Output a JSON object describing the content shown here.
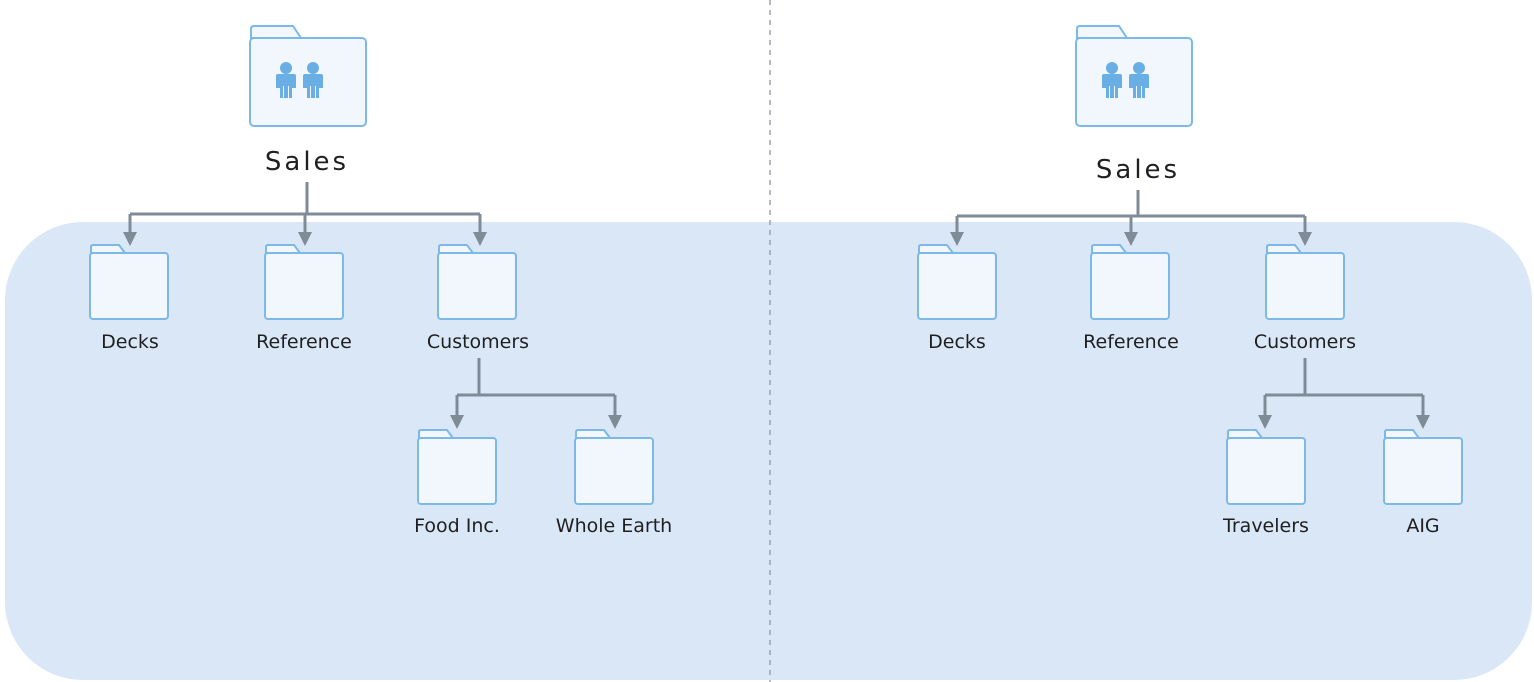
{
  "left_tree": {
    "root": {
      "label": "Sales",
      "icon": "shared-folder-icon"
    },
    "children": [
      {
        "label": "Decks",
        "icon": "folder-icon"
      },
      {
        "label": "Reference",
        "icon": "folder-icon"
      },
      {
        "label": "Customers",
        "icon": "folder-icon"
      }
    ],
    "grandchildren": [
      {
        "label": "Food Inc.",
        "icon": "folder-icon"
      },
      {
        "label": "Whole Earth",
        "icon": "folder-icon"
      }
    ]
  },
  "right_tree": {
    "root": {
      "label": "Sales",
      "icon": "shared-folder-icon"
    },
    "children": [
      {
        "label": "Decks",
        "icon": "folder-icon"
      },
      {
        "label": "Reference",
        "icon": "folder-icon"
      },
      {
        "label": "Customers",
        "icon": "folder-icon"
      }
    ],
    "grandchildren": [
      {
        "label": "Travelers",
        "icon": "folder-icon"
      },
      {
        "label": "AIG",
        "icon": "folder-icon"
      }
    ]
  },
  "colors": {
    "panel_fill": "#dae7f7",
    "connector": "#7f8b96",
    "folder_stroke": "#7db9e8",
    "folder_fill": "#f2f7fd",
    "people_icon": "#6aaee6",
    "divider": "#9aa3ad"
  }
}
